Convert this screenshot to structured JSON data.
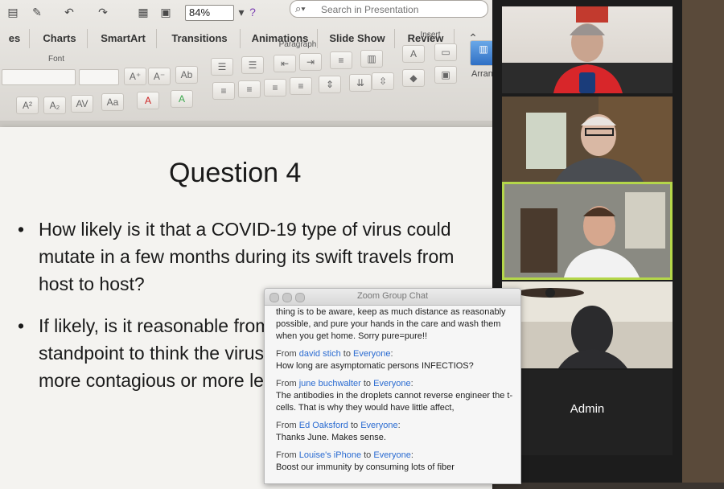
{
  "toolbar": {
    "zoom": "84%",
    "search_placeholder": "Search in Presentation",
    "tabs": [
      "es",
      "Charts",
      "SmartArt",
      "Transitions",
      "Animations",
      "Slide Show",
      "Review"
    ],
    "groups": {
      "font": "Font",
      "paragraph": "Paragraph",
      "insert": "Insert"
    },
    "arrange_label": "Arran"
  },
  "slide": {
    "title": "Question 4",
    "bullets": [
      "How likely is it that a COVID-19 type of virus could mutate in a few months during its swift travels from host to host?",
      "If likely, is it reasonable from an evolutionary standpoint to think the virus could mutate toward a more contagious or more lethal version?  Fred C."
    ]
  },
  "gallery": {
    "admin_label": "Admin"
  },
  "chat": {
    "title": "Zoom Group Chat",
    "prev_text": "thing is to be aware, keep as much distance as reasonably possible, and pure your hands in the care and wash them when you get home. Sorry pure=pure!!",
    "messages": [
      {
        "from": "david stich",
        "to": "Everyone",
        "text": "How long are asymptomatic persons INFECTIOS?"
      },
      {
        "from": "june buchwalter",
        "to": "Everyone",
        "text": "The antibodies in the droplets cannot reverse engineer the t-cells. That is why they would have little affect,"
      },
      {
        "from": "Ed Oaksford",
        "to": "Everyone",
        "text": "Thanks June. Makes sense."
      },
      {
        "from": "Louise's iPhone",
        "to": "Everyone",
        "text": "Boost our immunity by consuming lots of fiber"
      }
    ],
    "from_word": "From",
    "to_word": "to"
  },
  "colors": {
    "accent_link": "#2a6bd1",
    "ribbon_bg": "#e4e1dc",
    "zoom_active_border": "#b4d64a"
  }
}
